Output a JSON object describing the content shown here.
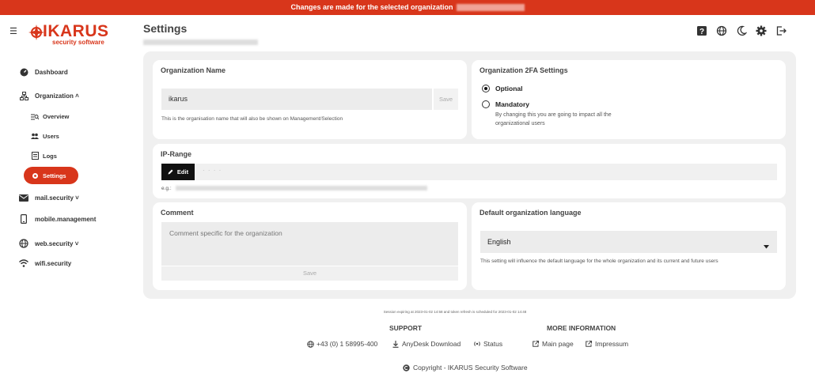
{
  "banner": {
    "text": "Changes are made for the selected organization"
  },
  "logo": {
    "word": "IKARUS",
    "sub": "security software"
  },
  "header": {
    "title": "Settings"
  },
  "sidebar": {
    "items": [
      {
        "label": "Dashboard"
      },
      {
        "label": "Organization ˄"
      },
      {
        "label": "Overview"
      },
      {
        "label": "Users"
      },
      {
        "label": "Logs"
      },
      {
        "label": "Settings"
      },
      {
        "label": "mail.security ˅"
      },
      {
        "label": "mobile.management"
      },
      {
        "label": "web.security ˅"
      },
      {
        "label": "wifi.security"
      }
    ]
  },
  "org_name": {
    "title": "Organization Name",
    "value": "ikarus",
    "save": "Save",
    "hint": "This is the organisation name that will also be shown on Management/Selection"
  },
  "twofa": {
    "title": "Organization 2FA Settings",
    "optional": "Optional",
    "mandatory": "Mandatory",
    "note": "By changing this you are going to impact all the organizational users"
  },
  "iprange": {
    "title": "IP-Range",
    "edit": "Edit",
    "dots": "· · · ·",
    "eg": "e.g.:"
  },
  "comment": {
    "title": "Comment",
    "placeholder": "Comment specific for the organization",
    "save": "Save"
  },
  "language": {
    "title": "Default organization language",
    "value": "English",
    "hint": "This setting will influence the default language for the whole organization and its current and future users"
  },
  "footer": {
    "session": "Session expiring at 2023-01-02 14:58 and token refresh is scheduled for 2023-01-02 14:48",
    "support_title": "SUPPORT",
    "phone": "+43 (0) 1 58995-400",
    "anydesk": "AnyDesk Download",
    "status": "Status",
    "more_title": "MORE INFORMATION",
    "main_page": "Main page",
    "impressum": "Impressum",
    "copyright": "Copyright - IKARUS Security Software"
  },
  "colors": {
    "accent": "#d8361b"
  }
}
